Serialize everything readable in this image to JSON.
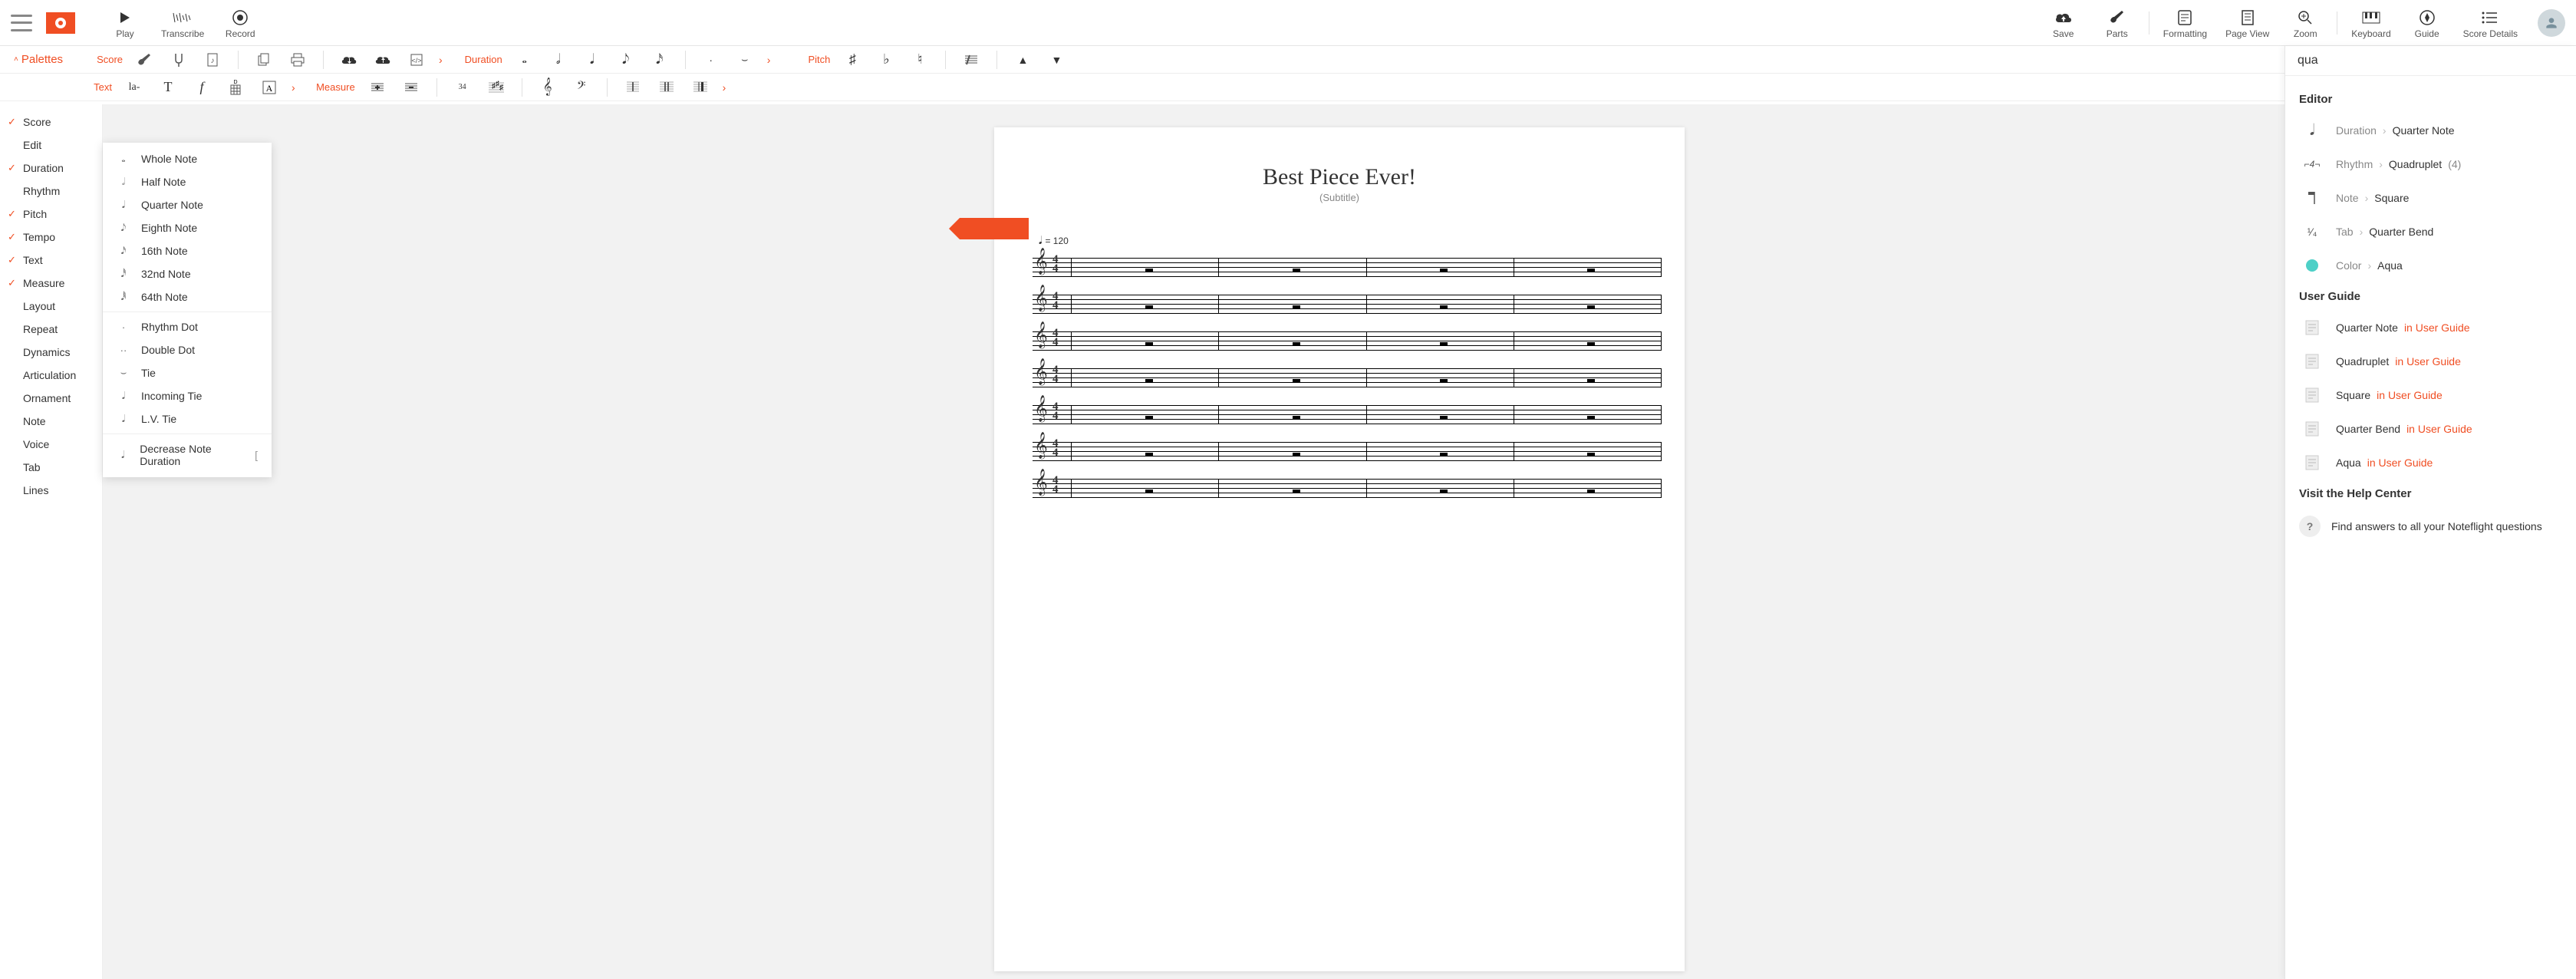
{
  "toolbar": {
    "play": "Play",
    "transcribe": "Transcribe",
    "record": "Record",
    "save": "Save",
    "parts": "Parts",
    "formatting": "Formatting",
    "pageview": "Page View",
    "zoom": "Zoom",
    "keyboard": "Keyboard",
    "guide": "Guide",
    "scoredetails": "Score Details"
  },
  "palettes": {
    "toggle": "Palettes",
    "row1": {
      "score": "Score",
      "duration": "Duration",
      "pitch": "Pitch"
    },
    "row2": {
      "text": "Text",
      "measure": "Measure"
    }
  },
  "leftPanel": {
    "items": [
      {
        "label": "Score",
        "checked": true
      },
      {
        "label": "Edit",
        "checked": false
      },
      {
        "label": "Duration",
        "checked": true
      },
      {
        "label": "Rhythm",
        "checked": false
      },
      {
        "label": "Pitch",
        "checked": true
      },
      {
        "label": "Tempo",
        "checked": true
      },
      {
        "label": "Text",
        "checked": true
      },
      {
        "label": "Measure",
        "checked": true
      },
      {
        "label": "Layout",
        "checked": false
      },
      {
        "label": "Repeat",
        "checked": false
      },
      {
        "label": "Dynamics",
        "checked": false
      },
      {
        "label": "Articulation",
        "checked": false
      },
      {
        "label": "Ornament",
        "checked": false
      },
      {
        "label": "Note",
        "checked": false
      },
      {
        "label": "Voice",
        "checked": false
      },
      {
        "label": "Tab",
        "checked": false
      },
      {
        "label": "Lines",
        "checked": false
      }
    ]
  },
  "submenu": {
    "groups": [
      [
        {
          "icon": "𝅝",
          "label": "Whole Note"
        },
        {
          "icon": "𝅗𝅥",
          "label": "Half Note"
        },
        {
          "icon": "𝅘𝅥",
          "label": "Quarter Note"
        },
        {
          "icon": "𝅘𝅥𝅮",
          "label": "Eighth Note"
        },
        {
          "icon": "𝅘𝅥𝅯",
          "label": "16th Note"
        },
        {
          "icon": "𝅘𝅥𝅰",
          "label": "32nd Note"
        },
        {
          "icon": "𝅘𝅥𝅱",
          "label": "64th Note"
        }
      ],
      [
        {
          "icon": "·",
          "label": "Rhythm Dot"
        },
        {
          "icon": "··",
          "label": "Double Dot"
        },
        {
          "icon": "⌣",
          "label": "Tie"
        },
        {
          "icon": "𝅘𝅥",
          "label": "Incoming Tie"
        },
        {
          "icon": "𝅘𝅥",
          "label": "L.V. Tie"
        }
      ],
      [
        {
          "icon": "𝅘𝅥",
          "label": "Decrease Note Duration",
          "shortcut": "["
        }
      ]
    ]
  },
  "score": {
    "title": "Best Piece Ever!",
    "subtitle": "(Subtitle)",
    "tempo_note": "𝅘𝅥",
    "tempo_eq": "= 120",
    "timesig_top": "4",
    "timesig_bot": "4"
  },
  "search": {
    "query": "qua",
    "editorHeader": "Editor",
    "results": [
      {
        "icon": "quarter-note",
        "crumb": "Duration",
        "label": "Quarter Note"
      },
      {
        "icon": "quadruplet",
        "crumb": "Rhythm",
        "label": "Quadruplet",
        "suffix": "(4)"
      },
      {
        "icon": "square",
        "crumb": "Note",
        "label": "Square"
      },
      {
        "icon": "quarter-bend",
        "crumb": "Tab",
        "label": "Quarter Bend"
      },
      {
        "icon": "aqua",
        "crumb": "Color",
        "label": "Aqua"
      }
    ],
    "guideHeader": "User Guide",
    "guideResults": [
      {
        "label": "Quarter Note",
        "link": "in User Guide"
      },
      {
        "label": "Quadruplet",
        "link": "in User Guide"
      },
      {
        "label": "Square",
        "link": "in User Guide"
      },
      {
        "label": "Quarter Bend",
        "link": "in User Guide"
      },
      {
        "label": "Aqua",
        "link": "in User Guide"
      }
    ],
    "helpHeader": "Visit the Help Center",
    "helpText": "Find answers to all your Noteflight questions"
  }
}
